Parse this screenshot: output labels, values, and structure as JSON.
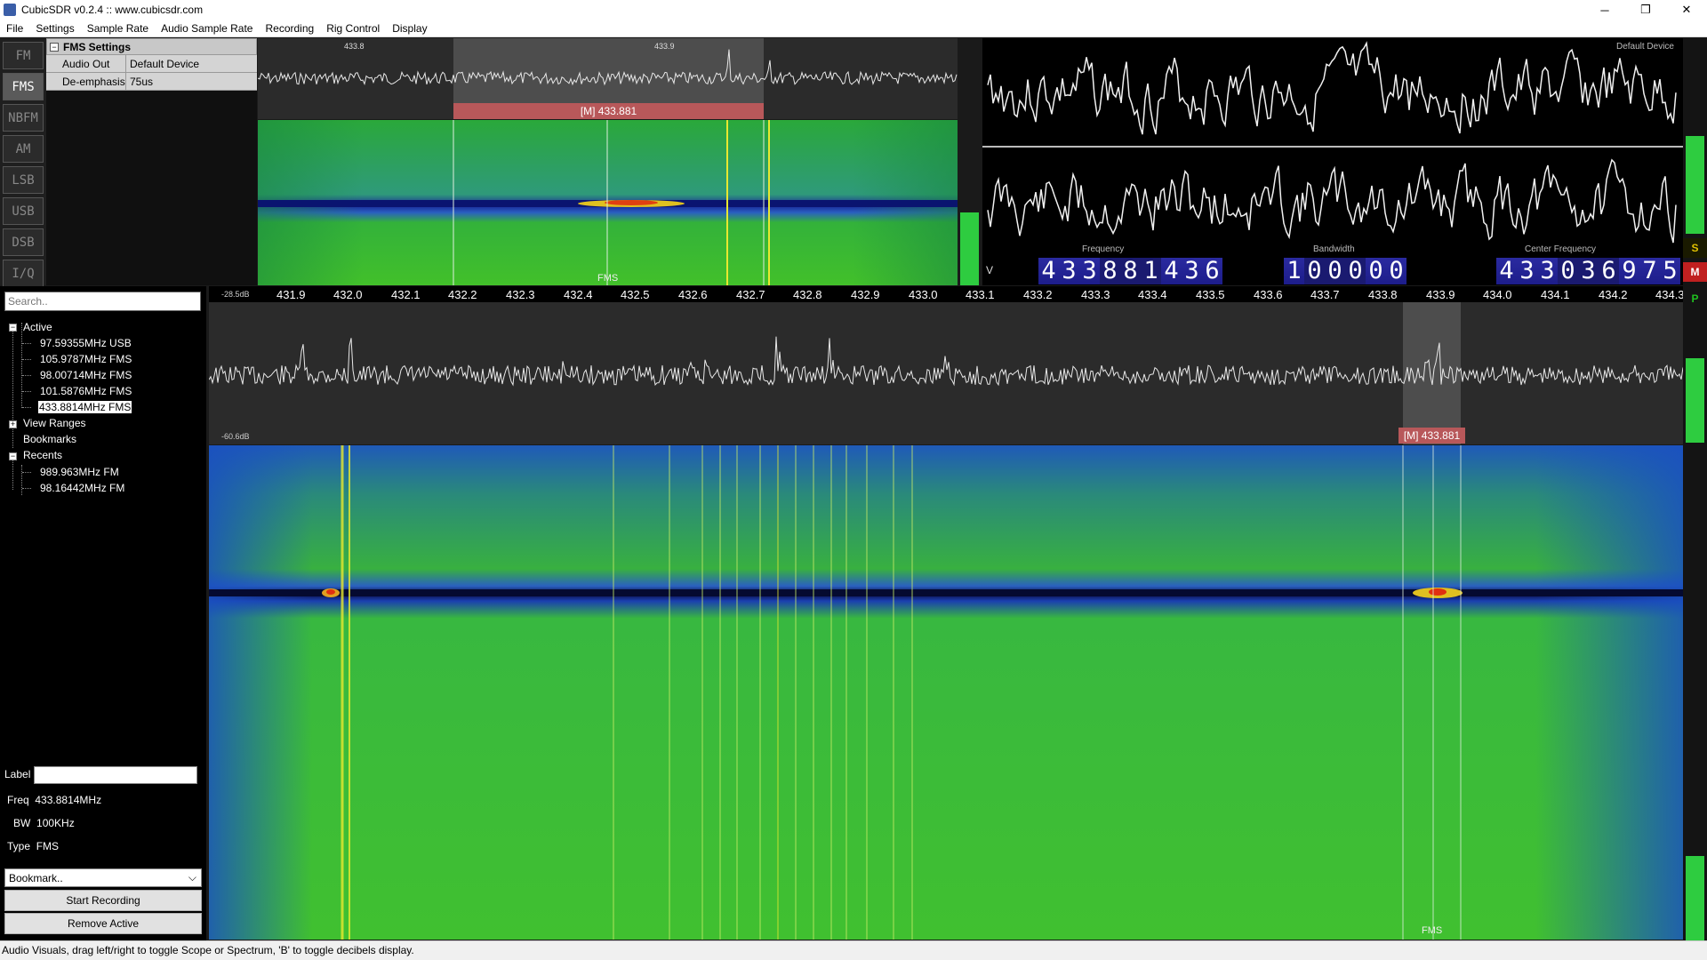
{
  "window": {
    "title": "CubicSDR v0.2.4 :: www.cubicsdr.com",
    "minimize": "─",
    "maximize": "❐",
    "close": "✕"
  },
  "menu": [
    "File",
    "Settings",
    "Sample Rate",
    "Audio Sample Rate",
    "Recording",
    "Rig Control",
    "Display"
  ],
  "modes": [
    {
      "label": "FM",
      "active": false
    },
    {
      "label": "FMS",
      "active": true
    },
    {
      "label": "NBFM",
      "active": false
    },
    {
      "label": "AM",
      "active": false
    },
    {
      "label": "LSB",
      "active": false
    },
    {
      "label": "USB",
      "active": false
    },
    {
      "label": "DSB",
      "active": false
    },
    {
      "label": "I/Q",
      "active": false
    }
  ],
  "fms_settings": {
    "header": "FMS Settings",
    "collapse_glyph": "−",
    "audio_out_label": "Audio Out",
    "audio_out_value": "Default Device",
    "deemphasis_label": "De-emphasis",
    "deemphasis_value": "75us"
  },
  "demod_spectrum": {
    "tick_left": "433.8",
    "tick_right": "433.9",
    "band_label": "[M]  433.881",
    "mode_label": "FMS"
  },
  "scope": {
    "device": "Default  Device"
  },
  "freq": {
    "v_tag": "V",
    "frequency_label": "Frequency",
    "frequency_digits": [
      "4",
      "3",
      "3",
      "8",
      "8",
      "1",
      "4",
      "3",
      "6"
    ],
    "bandwidth_label": "Bandwidth",
    "bandwidth_digits": [
      "1",
      "0",
      "0",
      "0",
      "0",
      "0"
    ],
    "center_label": "Center  Frequency",
    "center_digits": [
      "4",
      "3",
      "3",
      "0",
      "3",
      "6",
      "9",
      "7",
      "5"
    ]
  },
  "right_strip": {
    "s": "S",
    "m": "M",
    "p": "P",
    "colors": {
      "s": "#e0c000",
      "m": "#e02020",
      "p": "#20c020"
    }
  },
  "sidebar": {
    "search_placeholder": "Search..",
    "active_label": "Active",
    "active_items": [
      "97.59355MHz USB",
      "105.9787MHz FMS",
      "98.00714MHz FMS",
      "101.5876MHz FMS",
      "433.8814MHz FMS"
    ],
    "view_ranges_label": "View Ranges",
    "bookmarks_label": "Bookmarks",
    "recents_label": "Recents",
    "recent_items": [
      "989.963MHz FM",
      "98.16442MHz FM"
    ],
    "expand_glyph": "+",
    "collapse_glyph": "−"
  },
  "bookmark_panel": {
    "label_label": "Label",
    "freq_label": "Freq",
    "freq_value": "433.8814MHz",
    "bw_label": "BW",
    "bw_value": "100KHz",
    "type_label": "Type",
    "type_value": "FMS",
    "select_value": "Bookmark..",
    "select_arrow": "⌵",
    "start_recording": "Start Recording",
    "remove_active": "Remove Active"
  },
  "main_spectrum": {
    "db_top": "-28.5dB",
    "db_bottom": "-60.6dB",
    "ticks": [
      "431.9",
      "432.0",
      "432.1",
      "432.2",
      "432.3",
      "432.4",
      "432.5",
      "432.6",
      "432.7",
      "432.8",
      "432.9",
      "433.0",
      "433.1",
      "433.2",
      "433.3",
      "433.4",
      "433.5",
      "433.6",
      "433.7",
      "433.8",
      "433.9",
      "434.0",
      "434.1",
      "434.2",
      "434.3"
    ],
    "band_label": "[M]  433.881",
    "mode_label": "FMS"
  },
  "status": "Audio Visuals, drag left/right to toggle Scope or Spectrum, 'B' to toggle decibels display."
}
